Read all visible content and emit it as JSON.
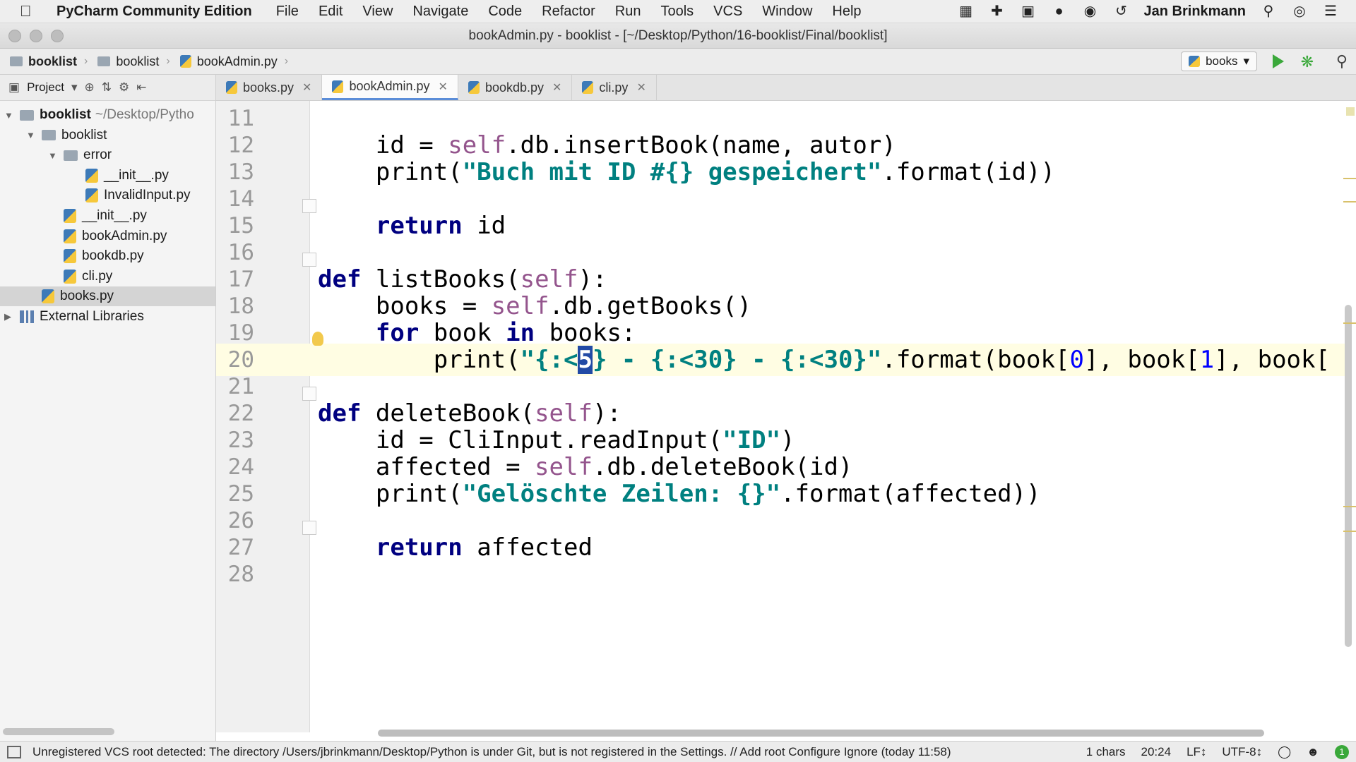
{
  "menubar": {
    "app_name": "PyCharm Community Edition",
    "items": [
      "File",
      "Edit",
      "View",
      "Navigate",
      "Code",
      "Refactor",
      "Run",
      "Tools",
      "VCS",
      "Window",
      "Help"
    ],
    "user": "Jan Brinkmann"
  },
  "window": {
    "title": "bookAdmin.py - booklist - [~/Desktop/Python/16-booklist/Final/booklist]"
  },
  "navbar": {
    "breadcrumbs": [
      "booklist",
      "booklist",
      "bookAdmin.py"
    ],
    "run_config": "books"
  },
  "project_panel": {
    "header": "Project",
    "tree": [
      {
        "label": "booklist",
        "path": "~/Desktop/Pytho",
        "type": "folder",
        "depth": 0,
        "expanded": true,
        "bold": true
      },
      {
        "label": "booklist",
        "type": "folder",
        "depth": 1,
        "expanded": true
      },
      {
        "label": "error",
        "type": "folder",
        "depth": 2,
        "expanded": true
      },
      {
        "label": "__init__.py",
        "type": "py",
        "depth": 3
      },
      {
        "label": "InvalidInput.py",
        "type": "py",
        "depth": 3
      },
      {
        "label": "__init__.py",
        "type": "py",
        "depth": 2
      },
      {
        "label": "bookAdmin.py",
        "type": "py",
        "depth": 2
      },
      {
        "label": "bookdb.py",
        "type": "py",
        "depth": 2
      },
      {
        "label": "cli.py",
        "type": "py",
        "depth": 2
      },
      {
        "label": "books.py",
        "type": "py",
        "depth": 1,
        "selected": true
      },
      {
        "label": "External Libraries",
        "type": "lib",
        "depth": 0,
        "expanded": false
      }
    ]
  },
  "tabs": [
    {
      "label": "books.py",
      "active": false
    },
    {
      "label": "bookAdmin.py",
      "active": true
    },
    {
      "label": "bookdb.py",
      "active": false
    },
    {
      "label": "cli.py",
      "active": false
    }
  ],
  "editor": {
    "current_line": 20,
    "lines": [
      {
        "num": "11",
        "html": ""
      },
      {
        "num": "12",
        "html": "    id = <span class=\"self\">self</span>.db.insertBook(name, autor)"
      },
      {
        "num": "13",
        "html": "    print(<span class=\"str\">\"Buch mit ID #{} gespeichert\"</span>.format(id))"
      },
      {
        "num": "14",
        "html": ""
      },
      {
        "num": "15",
        "html": "    <span class=\"kw\">return</span> id"
      },
      {
        "num": "16",
        "html": ""
      },
      {
        "num": "17",
        "html": "<span class=\"kw\">def</span> listBooks(<span class=\"self\">self</span>):"
      },
      {
        "num": "18",
        "html": "    books = <span class=\"self\">self</span>.db.getBooks()"
      },
      {
        "num": "19",
        "html": "    <span class=\"kw\">for</span> book <span class=\"kw\">in</span> books:"
      },
      {
        "num": "20",
        "html": "        print(<span class=\"str\">\"{:&lt;<span class=\"caret\">5</span>} - {:&lt;30} - {:&lt;30}\"</span>.format(book[<span style=\"color:#0000ff\">0</span>], book[<span style=\"color:#0000ff\">1</span>], book["
      },
      {
        "num": "21",
        "html": ""
      },
      {
        "num": "22",
        "html": "<span class=\"kw\">def</span> deleteBook(<span class=\"self\">self</span>):"
      },
      {
        "num": "23",
        "html": "    id = CliInput.readInput(<span class=\"str\">\"ID\"</span>)"
      },
      {
        "num": "24",
        "html": "    affected = <span class=\"self\">self</span>.db.deleteBook(id)"
      },
      {
        "num": "25",
        "html": "    print(<span class=\"str\">\"Gelöschte Zeilen: {}\"</span>.format(affected))"
      },
      {
        "num": "26",
        "html": ""
      },
      {
        "num": "27",
        "html": "    <span class=\"kw\">return</span> affected"
      },
      {
        "num": "28",
        "html": ""
      }
    ]
  },
  "statusbar": {
    "message": "Unregistered VCS root detected: The directory /Users/jbrinkmann/Desktop/Python is under Git, but is not registered in the Settings. // Add root  Configure  Ignore (today 11:58)",
    "chars": "1 chars",
    "position": "20:24",
    "line_sep": "LF↕",
    "encoding": "UTF-8↕"
  }
}
